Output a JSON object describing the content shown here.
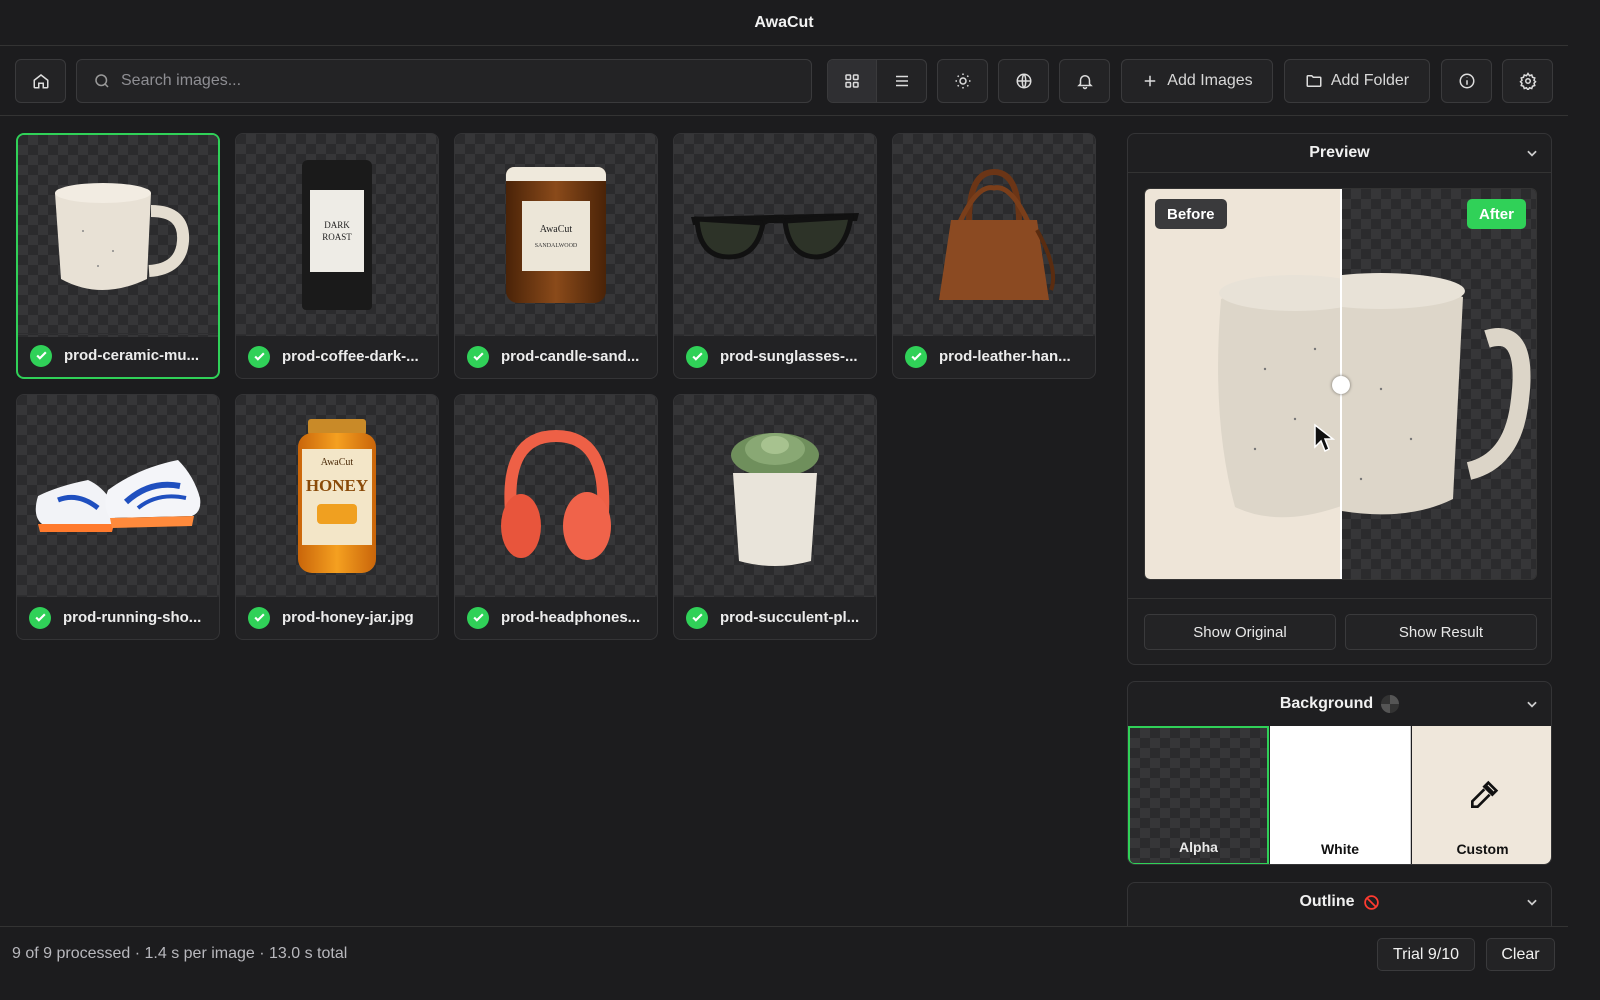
{
  "app": {
    "title": "AwaCut"
  },
  "toolbar": {
    "search_placeholder": "Search images...",
    "add_images_label": "Add Images",
    "add_folder_label": "Add Folder",
    "icons": [
      "home-icon",
      "search-icon",
      "grid-view-icon",
      "list-view-icon",
      "brightness-icon",
      "globe-icon",
      "bell-icon",
      "plus-icon",
      "folder-icon",
      "info-icon",
      "gear-icon"
    ]
  },
  "grid": {
    "items": [
      {
        "name": "prod-ceramic-mu...",
        "status": "done",
        "selected": true
      },
      {
        "name": "prod-coffee-dark-...",
        "status": "done"
      },
      {
        "name": "prod-candle-sand...",
        "status": "done"
      },
      {
        "name": "prod-sunglasses-...",
        "status": "done"
      },
      {
        "name": "prod-leather-han...",
        "status": "done"
      },
      {
        "name": "prod-running-sho...",
        "status": "done"
      },
      {
        "name": "prod-honey-jar.jpg",
        "status": "done"
      },
      {
        "name": "prod-headphones...",
        "status": "done"
      },
      {
        "name": "prod-succulent-pl...",
        "status": "done"
      }
    ],
    "product_labels": {
      "coffee_brand": "DARK ROAST",
      "candle_brand": "AwaCut",
      "candle_scent": "SANDALWOOD",
      "honey_brand": "AwaCut",
      "honey_word": "HONEY"
    }
  },
  "preview": {
    "title": "Preview",
    "before_label": "Before",
    "after_label": "After",
    "split_fraction": 0.5,
    "show_original_label": "Show Original",
    "show_result_label": "Show Result"
  },
  "background": {
    "title": "Background",
    "options": [
      {
        "label": "Alpha",
        "selected": true
      },
      {
        "label": "White"
      },
      {
        "label": "Custom"
      }
    ]
  },
  "outline": {
    "title": "Outline"
  },
  "status": {
    "summary": "9 of 9 processed · 1.4 s per image · 13.0 s total",
    "trial_label": "Trial 9/10",
    "clear_label": "Clear"
  },
  "colors": {
    "accent": "#30d158",
    "background": "#1c1c1e",
    "danger": "#ff3b30"
  }
}
